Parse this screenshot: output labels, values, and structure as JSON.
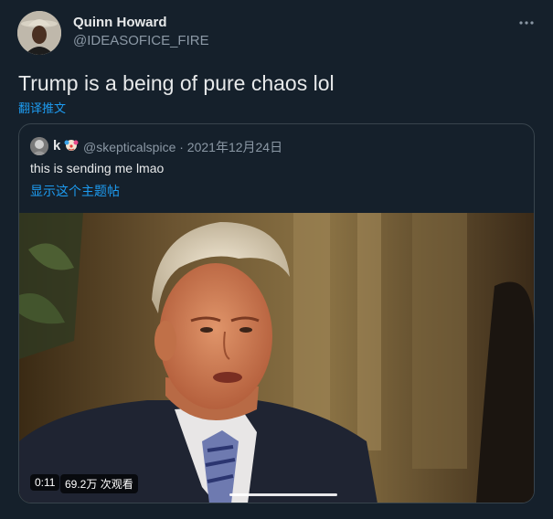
{
  "author": {
    "display_name": "Quinn Howard",
    "handle": "@IDEASOFICE_FIRE"
  },
  "tweet": {
    "text": "Trump is a being of pure chaos lol",
    "translate_label": "翻译推文"
  },
  "quoted": {
    "name": "k",
    "meta": "@skepticalspice · 2021年12月24日",
    "text": "this is sending me lmao",
    "show_thread_label": "显示这个主题帖"
  },
  "video": {
    "elapsed": "0:11",
    "views": "69.2万 次观看"
  },
  "colors": {
    "background": "#15202b",
    "link": "#1d9bf0",
    "secondary_text": "#8b98a5",
    "border": "#38444d"
  },
  "icons": {
    "more": "more-horizontal-icon"
  }
}
